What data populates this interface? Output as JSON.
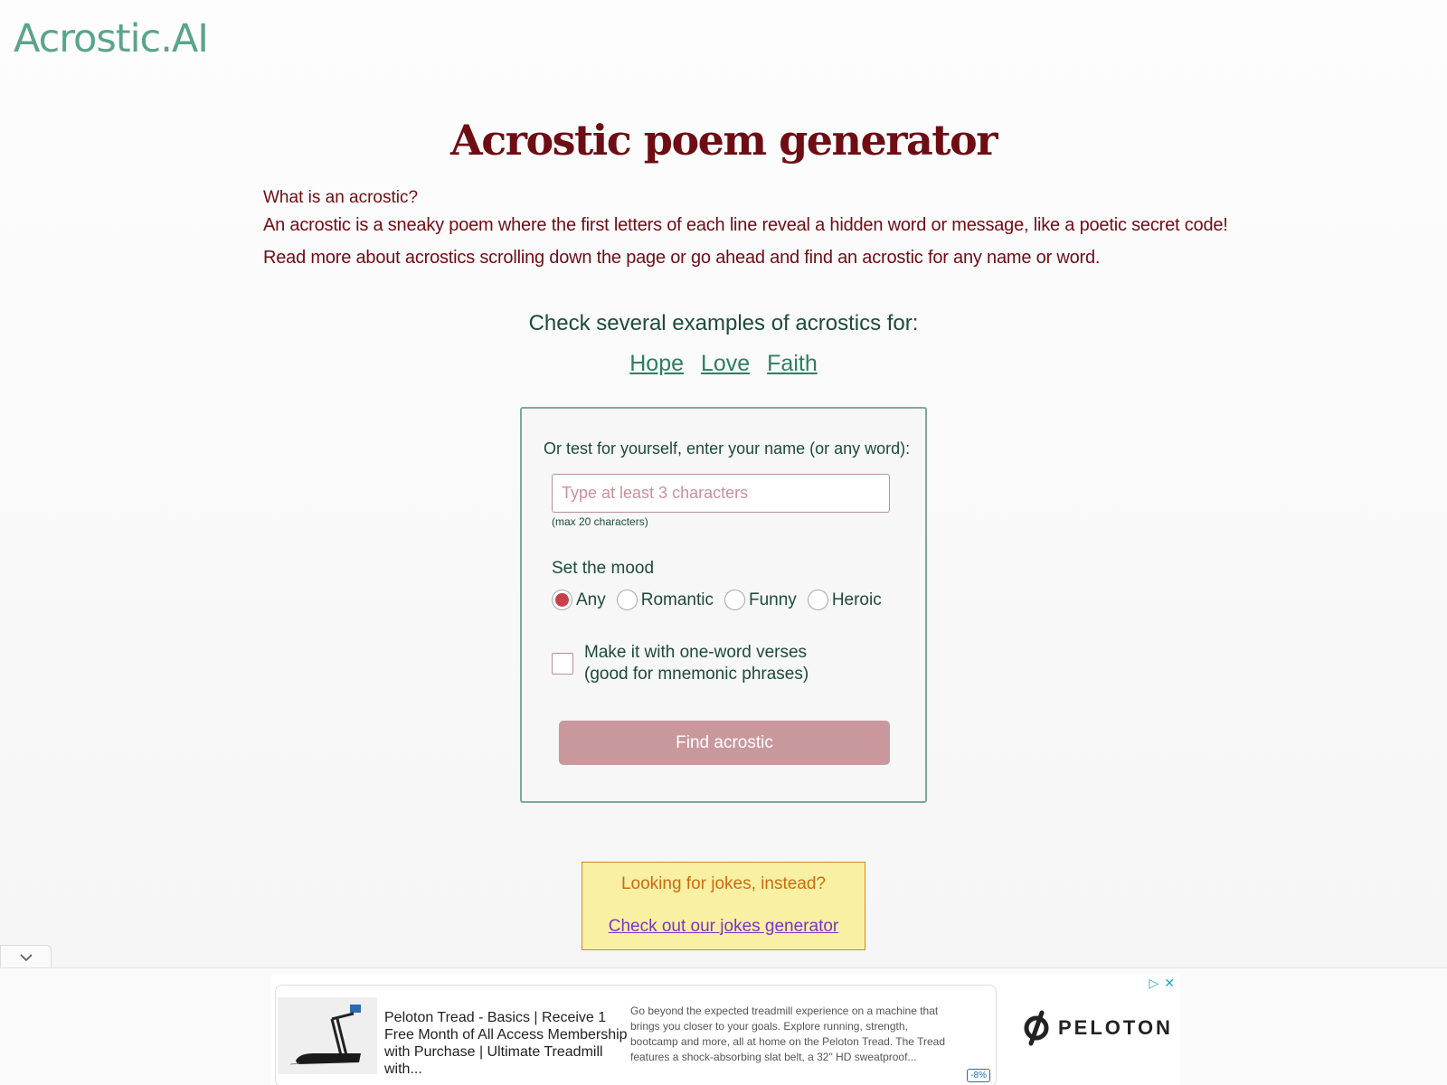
{
  "header": {
    "logo": "Acrostic.AI"
  },
  "page": {
    "title": "Acrostic poem generator",
    "intro_question": "What is an acrostic?",
    "intro_paragraphs": [
      "An acrostic is a sneaky poem where the first letters of each line reveal a hidden word or message, like a poetic secret code!",
      "Read more about acrostics scrolling down the page or go ahead and find an acrostic for any name or word."
    ]
  },
  "examples": {
    "title": "Check several examples of acrostics for:",
    "links": [
      "Hope",
      "Love",
      "Faith"
    ]
  },
  "form": {
    "label": "Or test for yourself, enter your name (or any word):",
    "input_value": "",
    "input_placeholder": "Type at least 3 characters",
    "max_hint": "(max 20 characters)",
    "mood_label": "Set the mood",
    "moods": [
      {
        "label": "Any",
        "checked": true
      },
      {
        "label": "Romantic",
        "checked": false
      },
      {
        "label": "Funny",
        "checked": false
      },
      {
        "label": "Heroic",
        "checked": false
      }
    ],
    "one_word_line1": "Make it with one-word verses",
    "one_word_line2": "(good for mnemonic phrases)",
    "one_word_checked": false,
    "submit_label": "Find acrostic"
  },
  "jokes": {
    "title": "Looking for jokes, instead?",
    "link": "Check out our jokes generator"
  },
  "ad": {
    "collapse_icon": "chevron-down-icon",
    "headline": "Peloton Tread - Basics | Receive 1 Free Month of All Access Membership with Purchase | Ultimate Treadmill with...",
    "description": "Go beyond the expected treadmill experience on a machine that brings you closer to your goals. Explore running, strength, bootcamp and more, all at home on the Peloton Tread. The Tread features a shock-absorbing slat belt, a 32\" HD sweatproof...",
    "badge": "-8%",
    "brand": "PELOTON",
    "colors": {
      "adchoices": "#2aa0c8"
    }
  },
  "colors": {
    "brand_green": "#5ba48c",
    "title_red": "#6e0d14",
    "button": "#c9989d",
    "radio_checked": "#c9404c",
    "jokes_bg": "#faf0a3"
  }
}
